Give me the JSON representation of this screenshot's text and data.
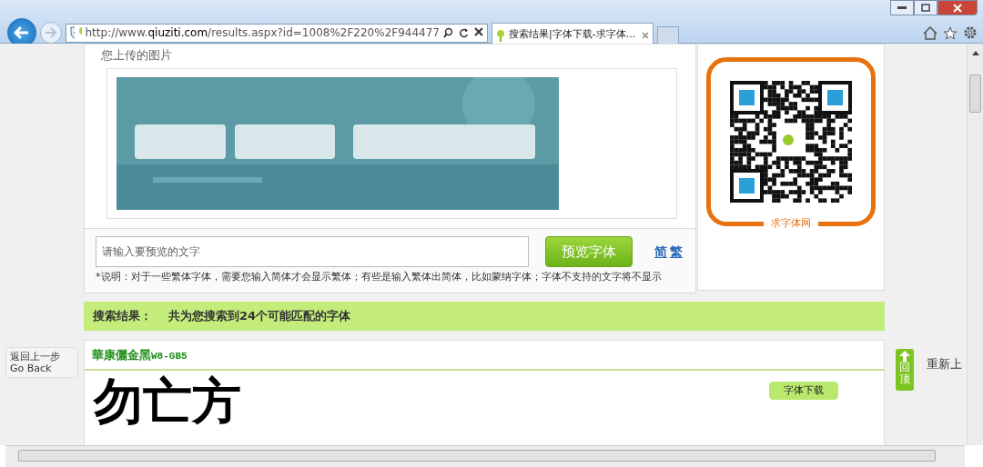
{
  "browser": {
    "url": "http://www.**qiuziti.com**/results.aspx?id=1008%2F220%2F944477",
    "tabs": [
      {
        "title": "搜索结果|字体下载-求字体...",
        "selected": true
      }
    ]
  },
  "upload": {
    "heading": "您上传的图片"
  },
  "qr": {
    "caption": "求字体网"
  },
  "preview": {
    "placeholder": "请输入要预览的文字",
    "button": "预览字体",
    "scripts": [
      {
        "label": "简",
        "selected": false
      },
      {
        "label": "繁",
        "selected": false
      }
    ],
    "note": "*说明：对于一些繁体字体，需要您输入简体才会显示繁体；有些是输入繁体出简体，比如蒙纳字体；字体不支持的文字将不显示"
  },
  "results_bar": {
    "label": "搜索结果：",
    "summary": "共为您搜索到24个可能匹配的字体"
  },
  "results": [
    {
      "font_name": "華康儷金黑",
      "font_code": "W8-GB5",
      "sample": "勿亡方",
      "buttons": [
        "字体下载"
      ]
    }
  ],
  "side": {
    "back": [
      "返回上一步",
      "Go Back"
    ],
    "top": "回顶",
    "reload": "重新上"
  }
}
